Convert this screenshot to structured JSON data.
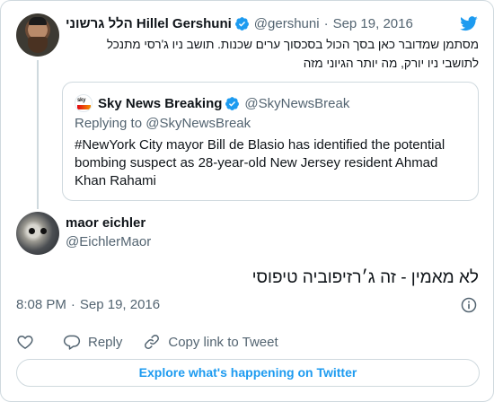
{
  "parent_tweet": {
    "display_name": "הלל גרשוני Hillel Gershuni",
    "handle": "@gershuni",
    "separator": "·",
    "date": "Sep 19, 2016",
    "text_line1": "מסתמן שמדובר כאן בסך הכול בסכסוך ערים שכנות. תושב ניו ג'רסי מתנכל",
    "text_line2": "לתושבי ניו יורק, מה יותר הגיוני מזה"
  },
  "quoted_tweet": {
    "display_name": "Sky News Breaking",
    "handle": "@SkyNewsBreak",
    "replying_to": "Replying to @SkyNewsBreak",
    "text": "#NewYork City mayor Bill de Blasio has identified the potential bombing suspect as 28-year-old New Jersey resident Ahmad Khan Rahami",
    "avatar_text": "sky"
  },
  "reply_tweet": {
    "display_name": "maor eichler",
    "handle": "@EichlerMaor",
    "text": "לא מאמין - זה ג׳רזיפוביה טיפוסי",
    "time": "8:08 PM",
    "separator": "·",
    "date": "Sep 19, 2016"
  },
  "actions": {
    "reply_label": "Reply",
    "copy_link_label": "Copy link to Tweet"
  },
  "explore_label": "Explore what's happening on Twitter",
  "colors": {
    "accent": "#1d9bf0",
    "secondary_text": "#536471",
    "border": "#cfd9de",
    "like_heart": "#536471"
  },
  "icons": [
    "verified-badge-icon",
    "twitter-bird-icon",
    "info-icon",
    "heart-icon",
    "reply-bubble-icon",
    "link-icon"
  ]
}
